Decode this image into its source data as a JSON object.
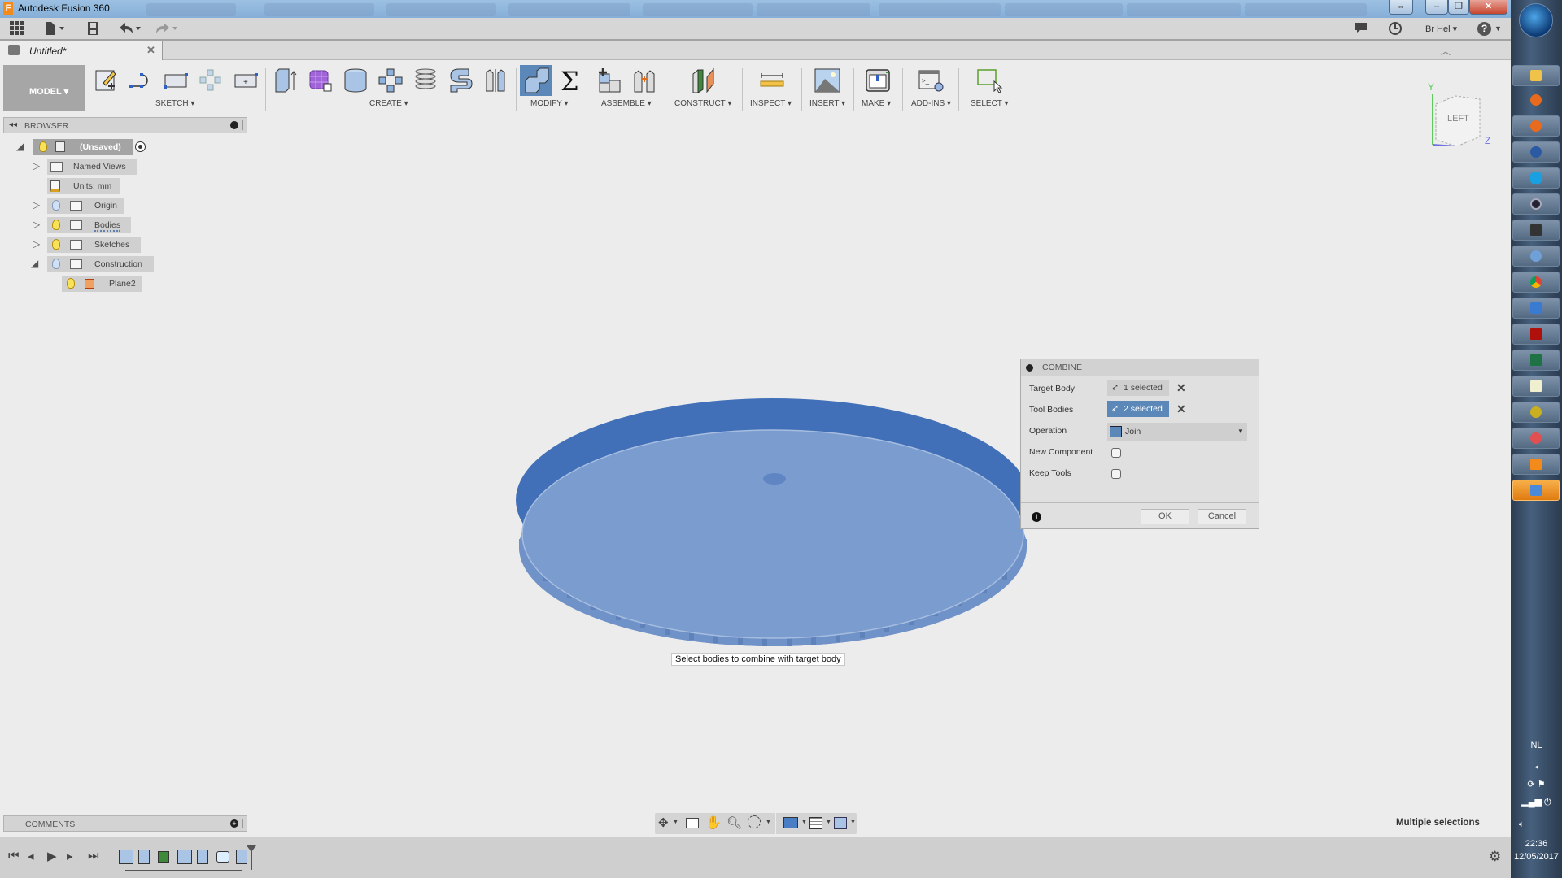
{
  "window": {
    "title": "Autodesk Fusion 360",
    "buttons": {
      "resize": "⇔",
      "minimize": "–",
      "maximize": "❐",
      "close": "✕"
    }
  },
  "quick_access": {
    "user": "Br Hel ▾",
    "help": "?"
  },
  "document_tab": {
    "label": "Untitled*",
    "close": "✕"
  },
  "ribbon": {
    "workspace": "MODEL ▾",
    "groups": [
      {
        "label": "SKETCH ▾"
      },
      {
        "label": "CREATE ▾"
      },
      {
        "label": "MODIFY ▾"
      },
      {
        "label": "ASSEMBLE ▾"
      },
      {
        "label": "CONSTRUCT ▾"
      },
      {
        "label": "INSPECT ▾"
      },
      {
        "label": "INSERT ▾"
      },
      {
        "label": "MAKE ▾"
      },
      {
        "label": "ADD-INS ▾"
      },
      {
        "label": "SELECT ▾"
      }
    ]
  },
  "browser": {
    "title": "BROWSER",
    "nodes": [
      {
        "label": "(Unsaved)",
        "icon": "component-icon"
      },
      {
        "label": "Named Views",
        "icon": "folder-icon"
      },
      {
        "label": "Units: mm",
        "icon": "units-icon"
      },
      {
        "label": "Origin",
        "icon": "folder-icon"
      },
      {
        "label": "Bodies",
        "icon": "folder-icon"
      },
      {
        "label": "Sketches",
        "icon": "folder-icon"
      },
      {
        "label": "Construction",
        "icon": "folder-icon"
      },
      {
        "label": "Plane2",
        "icon": "plane-icon"
      }
    ]
  },
  "viewcube": {
    "face": "LEFT",
    "axis_y": "Y",
    "axis_z": "Z"
  },
  "dialog": {
    "title": "COMBINE",
    "target_body": {
      "label": "Target Body",
      "value": "1 selected"
    },
    "tool_bodies": {
      "label": "Tool Bodies",
      "value": "2 selected"
    },
    "operation": {
      "label": "Operation",
      "value": "Join"
    },
    "new_component": {
      "label": "New Component",
      "checked": false
    },
    "keep_tools": {
      "label": "Keep Tools",
      "checked": false
    },
    "ok": "OK",
    "cancel": "Cancel"
  },
  "tooltip": "Select bodies to combine with target body",
  "comments": {
    "title": "COMMENTS"
  },
  "status": "Multiple selections",
  "taskbar": {
    "language": "NL",
    "time": "22:36",
    "date": "12/05/2017"
  },
  "colors": {
    "accent": "#5b88b8",
    "body_dark": "#4170b8",
    "body_light": "#7a9ccf"
  }
}
